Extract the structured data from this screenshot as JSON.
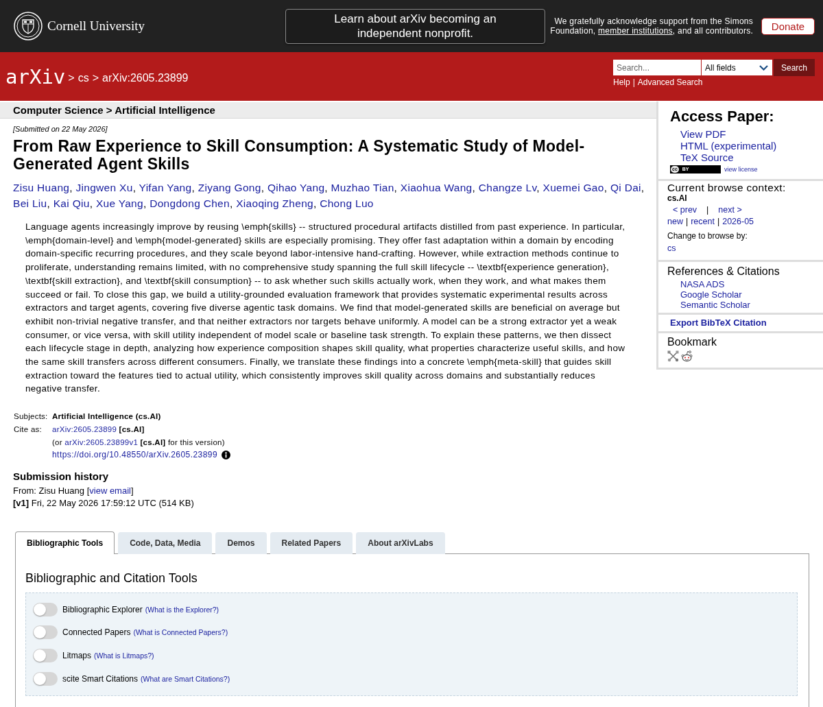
{
  "top_bar": {
    "institution": "Cornell University",
    "banner": "Learn about arXiv becoming an independent nonprofit.",
    "acknowledgement": {
      "before": "We gratefully acknowledge support from the Simons Foundation,",
      "link": "member institutions",
      "after": ", and all contributors."
    },
    "donate": "Donate"
  },
  "header": {
    "logo": "arXiv",
    "breadcrumb": {
      "separator": ">",
      "items": [
        "cs",
        "arXiv:2605.23899"
      ]
    },
    "search": {
      "placeholder": "Search...",
      "field": "All fields",
      "button": "Search"
    },
    "links": {
      "items": [
        "Help",
        "Advanced Search"
      ],
      "separator": "|"
    }
  },
  "subheader": "Computer Science > Artificial Intelligence",
  "paper": {
    "submitted": "[Submitted on 22 May 2026]",
    "title": "From Raw Experience to Skill Consumption: A Systematic Study of Model-Generated Agent Skills",
    "authors": [
      "Zisu Huang",
      "Jingwen Xu",
      "Yifan Yang",
      "Ziyang Gong",
      "Qihao Yang",
      "Muzhao Tian",
      "Xiaohua Wang",
      "Changze Lv",
      "Xuemei Gao",
      "Qi Dai",
      "Bei Liu",
      "Kai Qiu",
      "Xue Yang",
      "Dongdong Chen",
      "Xiaoqing Zheng",
      "Chong Luo"
    ],
    "author_separator": ",",
    "abstract": "Language agents increasingly improve by reusing \\emph{skills} -- structured procedural artifacts distilled from past experience. In particular, \\emph{domain-level} and \\emph{model-generated} skills are especially promising. They offer fast adaptation within a domain by encoding domain-specific recurring procedures, and they scale beyond labor-intensive hand-crafting. However, while extraction methods continue to proliferate, understanding remains limited, with no comprehensive study spanning the full skill lifecycle -- \\textbf{experience generation}, \\textbf{skill extraction}, and \\textbf{skill consumption} -- to ask whether such skills actually work, when they work, and what makes them succeed or fail. To close this gap, we build a utility-grounded evaluation framework that provides systematic experimental results across extractors and target agents, covering five diverse agentic task domains. We find that model-generated skills are beneficial on average but exhibit non-trivial negative transfer, and that neither extractors nor targets behave uniformly. A model can be a strong extractor yet a weak consumer, or vice versa, with skill utility independent of model scale or baseline task strength. To explain these patterns, we then dissect each lifecycle stage in depth, analyzing how experience composition shapes skill quality, what properties characterize useful skills, and how the same skill transfers across different consumers. Finally, we translate these findings into a concrete \\emph{meta-skill} that guides skill extraction toward the features tied to actual utility, which consistently improves skill quality across domains and substantially reduces negative transfer."
  },
  "metadata": {
    "subjects": {
      "label": "Subjects:",
      "value": "Artificial Intelligence (cs.AI)"
    },
    "cite_as": {
      "label": "Cite as:",
      "id": "arXiv:2605.23899",
      "category": "[cs.AI]",
      "version": {
        "before": "(or",
        "link": "arXiv:2605.23899v1",
        "category": "[cs.AI]",
        "after": "for this version)"
      },
      "doi": "https://doi.org/10.48550/arXiv.2605.23899"
    }
  },
  "submission_history": {
    "title": "Submission history",
    "from": {
      "before": "From: Zisu Huang [",
      "link": "view email",
      "after": "]"
    },
    "versions": [
      "**[v1]** Fri, 22 May 2026 17:59:12 UTC (514 KB)"
    ]
  },
  "labs": {
    "tabs": [
      {
        "label": "Bibliographic Tools",
        "selected": true
      },
      {
        "label": "Code, Data, Media",
        "selected": false
      },
      {
        "label": "Demos",
        "selected": false
      },
      {
        "label": "Related Papers",
        "selected": false
      },
      {
        "label": "About arXivLabs",
        "selected": false
      }
    ],
    "panel_title": "Bibliographic and Citation Tools",
    "tools": [
      {
        "label": "Bibliographic Explorer",
        "help": "(What is the Explorer?)",
        "on": false
      },
      {
        "label": "Connected Papers",
        "help": "(What is Connected Papers?)",
        "on": false
      },
      {
        "label": "Litmaps",
        "help": "(What is Litmaps?)",
        "on": false
      },
      {
        "label": "scite Smart Citations",
        "help": "(What are Smart Citations?)",
        "on": false
      }
    ]
  },
  "sidebar": {
    "access": {
      "title": "Access Paper:",
      "links": [
        "View PDF",
        "HTML (experimental)",
        "TeX Source"
      ],
      "license": {
        "mark": "cc",
        "label": "BY",
        "link": "view license"
      }
    },
    "browse": {
      "title": "Current browse context:",
      "context": "cs.AI",
      "prev": "< prev",
      "separator": "|",
      "next": "next >",
      "lists": [
        "new",
        "recent",
        "2026-05"
      ],
      "change_label": "Change to browse by:",
      "alternatives": [
        "cs"
      ]
    },
    "references": {
      "title": "References & Citations",
      "links": [
        "NASA ADS",
        "Google Scholar",
        "Semantic Scholar"
      ]
    },
    "export": "Export BibTeX Citation",
    "bookmark": {
      "title": "Bookmark"
    }
  }
}
